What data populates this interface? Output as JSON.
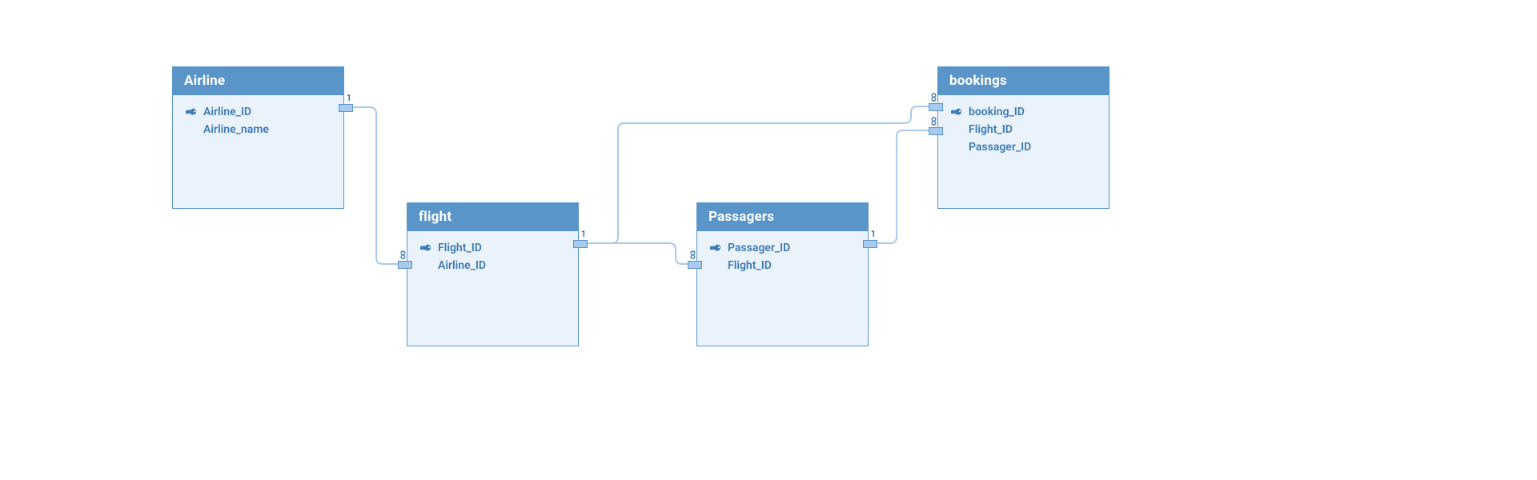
{
  "diagram": {
    "entities": {
      "airline": {
        "title": "Airline",
        "attrs": [
          {
            "name": "Airline_ID",
            "pk": true
          },
          {
            "name": "Airline_name",
            "pk": false
          }
        ],
        "ports": {
          "right1": {
            "cardinality": "1"
          }
        }
      },
      "flight": {
        "title": "flight",
        "attrs": [
          {
            "name": "Flight_ID",
            "pk": true
          },
          {
            "name": "Airline_ID",
            "pk": false
          }
        ],
        "ports": {
          "left1": {
            "cardinality": "∞"
          },
          "right1": {
            "cardinality": "1"
          }
        }
      },
      "passagers": {
        "title": "Passagers",
        "attrs": [
          {
            "name": "Passager_ID",
            "pk": true
          },
          {
            "name": "Flight_ID",
            "pk": false
          }
        ],
        "ports": {
          "left1": {
            "cardinality": "∞"
          },
          "right1": {
            "cardinality": "1"
          }
        }
      },
      "bookings": {
        "title": "bookings",
        "attrs": [
          {
            "name": "booking_ID",
            "pk": true
          },
          {
            "name": "Flight_ID",
            "pk": false
          },
          {
            "name": "Passager_ID",
            "pk": false
          }
        ],
        "ports": {
          "left1": {
            "cardinality": "∞"
          },
          "left2": {
            "cardinality": "∞"
          }
        }
      }
    },
    "relationships": [
      {
        "from": "airline.right1",
        "to": "flight.left1"
      },
      {
        "from": "flight.right1",
        "to": "passagers.left1"
      },
      {
        "from": "flight.right1",
        "to": "bookings.left1"
      },
      {
        "from": "passagers.right1",
        "to": "bookings.left2"
      }
    ]
  }
}
